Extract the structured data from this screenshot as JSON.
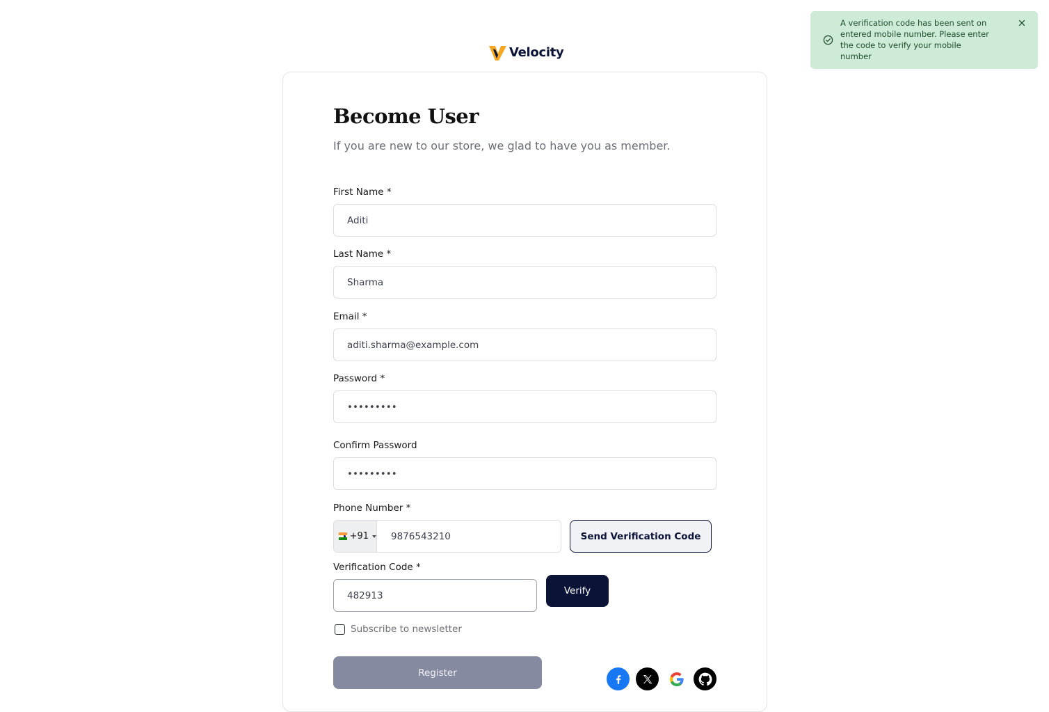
{
  "brand": {
    "name": "Velocity",
    "colors": {
      "navy": "#0b1437",
      "gold": "#f5a623"
    }
  },
  "toast": {
    "message": "A verification code has been sent on entered mobile number. Please enter the code to verify your mobile number",
    "icon": "check-circle-icon",
    "close_icon": "close-icon",
    "background": "#cdebd6"
  },
  "form": {
    "title": "Become User",
    "subtitle": "If you are new to our store, we glad to have you as member.",
    "first_name": {
      "label": "First Name *",
      "value": "Aditi"
    },
    "last_name": {
      "label": "Last Name *",
      "value": "Sharma"
    },
    "email": {
      "label": "Email *",
      "value": "aditi.sharma@example.com"
    },
    "password": {
      "label": "Password *",
      "value": "password1"
    },
    "confirm_password": {
      "label": "Confirm Password",
      "value": "password1"
    },
    "phone": {
      "label": "Phone Number *",
      "country_flag": "india-flag-icon",
      "dial_code": "+91",
      "value": "9876543210",
      "send_button": "Send Verification Code"
    },
    "verification": {
      "label": "Verification Code *",
      "value": "482913",
      "verify_button": "Verify"
    },
    "newsletter": {
      "label": "Subscribe to newsletter",
      "checked": false
    },
    "register_button": "Register"
  },
  "social": [
    {
      "name": "facebook-icon",
      "color": "#1877f2"
    },
    {
      "name": "x-icon",
      "color": "#000000"
    },
    {
      "name": "google-icon",
      "color": "#ffffff"
    },
    {
      "name": "github-icon",
      "color": "#000000"
    }
  ]
}
